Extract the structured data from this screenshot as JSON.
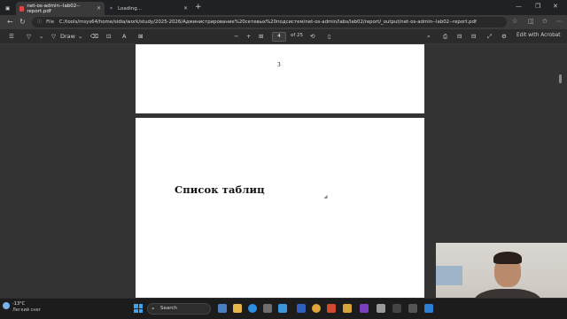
{
  "browser": {
    "tabs": [
      {
        "label": "net-os-admin--lab02--report.pdf",
        "active": true
      },
      {
        "label": "Loading...",
        "active": false
      }
    ],
    "url": {
      "scheme_label": "File",
      "path": "C:/tools/msys64/home/sidia/work/study/2025-2026/Администрирование%20сетевых%20подсистем/net-os-admin/labs/lab02/report/_output/net-os-admin--lab02--report.pdf"
    }
  },
  "pdf_toolbar": {
    "draw_label": "Draw",
    "page_current": "4",
    "page_total": "of 25",
    "edit_label": "Edit with Acrobat"
  },
  "document": {
    "prev_page_number": "3",
    "heading": "Список таблиц"
  },
  "taskbar": {
    "weather_temp": "-13°C",
    "weather_desc": "Легкий снег",
    "search_label": "Search"
  },
  "colors": {
    "doc_background": "#333333",
    "page": "#ffffff",
    "windows_accent": "#3ea6f0"
  }
}
